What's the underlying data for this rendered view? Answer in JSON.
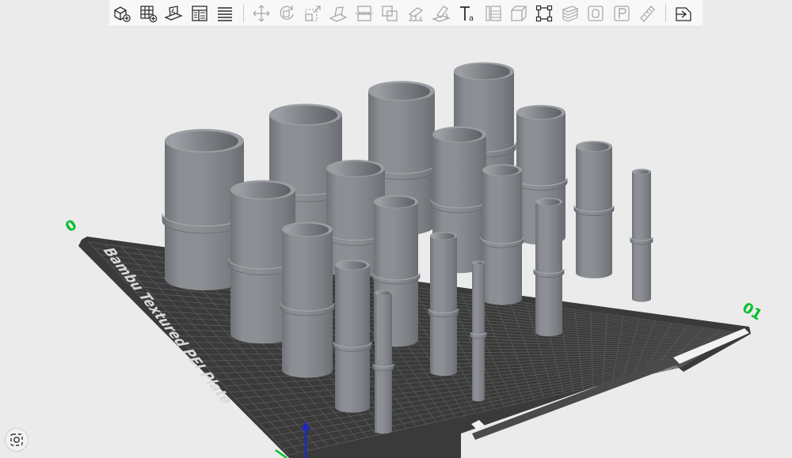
{
  "toolbar": {
    "items": [
      {
        "name": "add-object-button",
        "icon": "cube-add-icon",
        "enabled": true
      },
      {
        "name": "add-plate-button",
        "icon": "grid-add-icon",
        "enabled": true
      },
      {
        "name": "auto-orient-button",
        "icon": "plate-orient-icon",
        "enabled": true
      },
      {
        "name": "arrange-button",
        "icon": "arrange-layout-icon",
        "enabled": true
      },
      {
        "name": "layers-button",
        "icon": "layers-icon",
        "enabled": true
      },
      {
        "name": "move-button",
        "icon": "move-arrows-icon",
        "enabled": false
      },
      {
        "name": "rotate-button",
        "icon": "rotate-icon",
        "enabled": false
      },
      {
        "name": "scale-button",
        "icon": "scale-icon",
        "enabled": false
      },
      {
        "name": "lay-on-face-button",
        "icon": "lay-on-face-icon",
        "enabled": false
      },
      {
        "name": "cut-button",
        "icon": "cut-icon",
        "enabled": false
      },
      {
        "name": "boolean-button",
        "icon": "boolean-icon",
        "enabled": false
      },
      {
        "name": "support-paint-button",
        "icon": "support-paint-icon",
        "enabled": false
      },
      {
        "name": "seam-paint-button",
        "icon": "seam-paint-icon",
        "enabled": false
      },
      {
        "name": "text-button",
        "icon": "text-icon",
        "enabled": true
      },
      {
        "name": "height-range-button",
        "icon": "height-range-icon",
        "enabled": false
      },
      {
        "name": "mesh-boolean-button",
        "icon": "mesh-cube-icon",
        "enabled": false
      },
      {
        "name": "measure-box-button",
        "icon": "measure-box-icon",
        "enabled": true
      },
      {
        "name": "assembly-button",
        "icon": "assembly-icon",
        "enabled": false
      },
      {
        "name": "split-objects-button",
        "icon": "split-objects-icon",
        "enabled": false
      },
      {
        "name": "split-parts-button",
        "icon": "split-parts-icon",
        "enabled": false
      },
      {
        "name": "ruler-button",
        "icon": "ruler-icon",
        "enabled": false
      },
      {
        "name": "view-button",
        "icon": "view-icon",
        "enabled": true
      }
    ]
  },
  "plate": {
    "name": "Bambu Textured PEI Plate",
    "corner_left": "0",
    "corner_right": "01",
    "front_label": "",
    "front_right_label": ""
  },
  "colors": {
    "background": "#ebebeb",
    "plate": "#3a3a3a",
    "grid": "#5a5a5a",
    "part": "#7e8186",
    "axis_green": "#00c02a",
    "axis_blue": "#1a28c8"
  }
}
